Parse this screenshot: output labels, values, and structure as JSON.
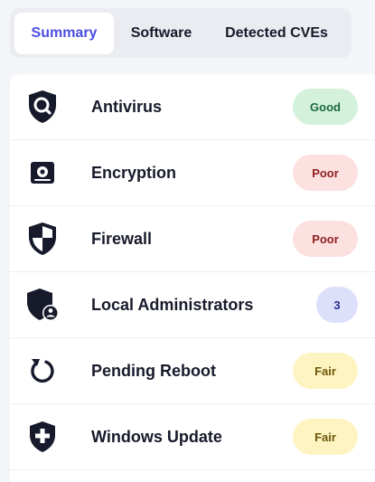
{
  "tabs": [
    {
      "label": "Summary",
      "active": true
    },
    {
      "label": "Software",
      "active": false
    },
    {
      "label": "Detected CVEs",
      "active": false
    }
  ],
  "rows": [
    {
      "label": "Antivirus",
      "icon": "shield-search-icon",
      "status": "Good",
      "status_color": "#d4f1dc"
    },
    {
      "label": "Encryption",
      "icon": "hard-drive-icon",
      "status": "Poor",
      "status_color": "#fde0e0"
    },
    {
      "label": "Firewall",
      "icon": "shield-icon",
      "status": "Poor",
      "status_color": "#fde0e0"
    },
    {
      "label": "Local Administrators",
      "icon": "shield-user-icon",
      "status": "3",
      "status_color": "#dde0fb"
    },
    {
      "label": "Pending Reboot",
      "icon": "reboot-icon",
      "status": "Fair",
      "status_color": "#fdf4c2"
    },
    {
      "label": "Windows Update",
      "icon": "shield-plus-icon",
      "status": "Fair",
      "status_color": "#fdf4c2"
    }
  ],
  "colors": {
    "accent": "#4a4ee0",
    "text": "#171a2b"
  }
}
